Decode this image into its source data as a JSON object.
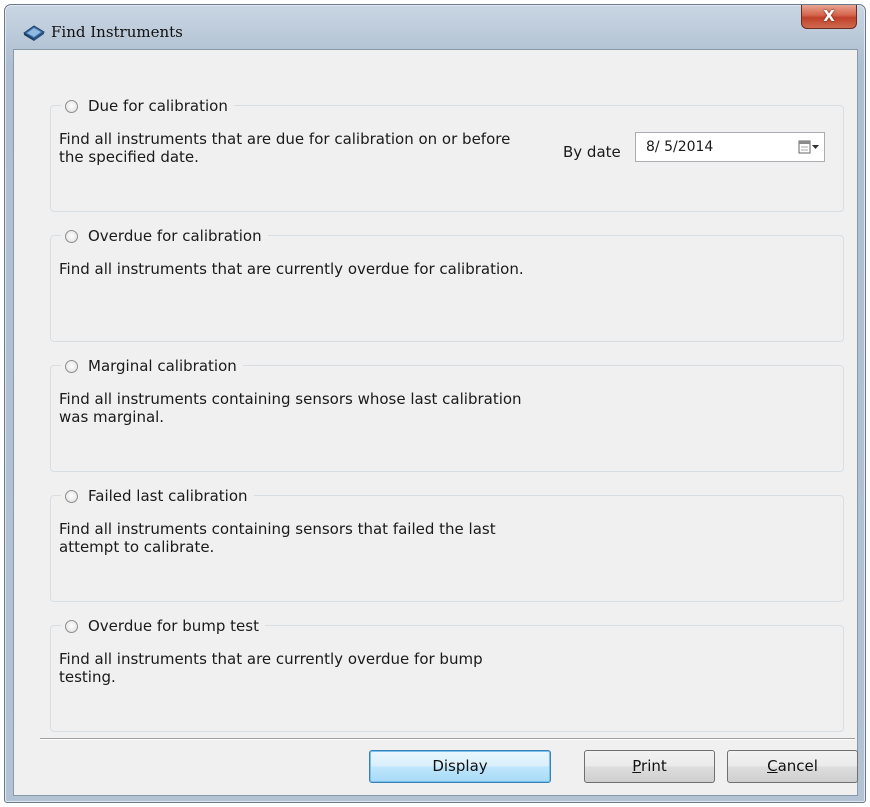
{
  "window": {
    "title": "Find Instruments",
    "close_label": "X"
  },
  "options": [
    {
      "label": "Due for calibration",
      "description": "Find all instruments that are due for calibration on or before the specified date."
    },
    {
      "label": "Overdue for calibration",
      "description": "Find all instruments that are currently overdue for calibration."
    },
    {
      "label": "Marginal calibration",
      "description": "Find all instruments containing sensors whose last calibration was marginal."
    },
    {
      "label": "Failed last calibration",
      "description": "Find all instruments containing sensors that failed the last attempt to calibrate."
    },
    {
      "label": "Overdue for bump test",
      "description": "Find all instruments that are currently overdue for bump testing."
    }
  ],
  "by_date": {
    "label": "By date",
    "value": "8/ 5/2014"
  },
  "buttons": {
    "display": "Display",
    "print": "Print",
    "cancel": "Cancel"
  },
  "icons": {
    "title": "instruments-book-icon",
    "calendar": "calendar-dropdown-icon"
  },
  "colors": {
    "accent": "#3c7fb1",
    "close": "#c0402a"
  }
}
